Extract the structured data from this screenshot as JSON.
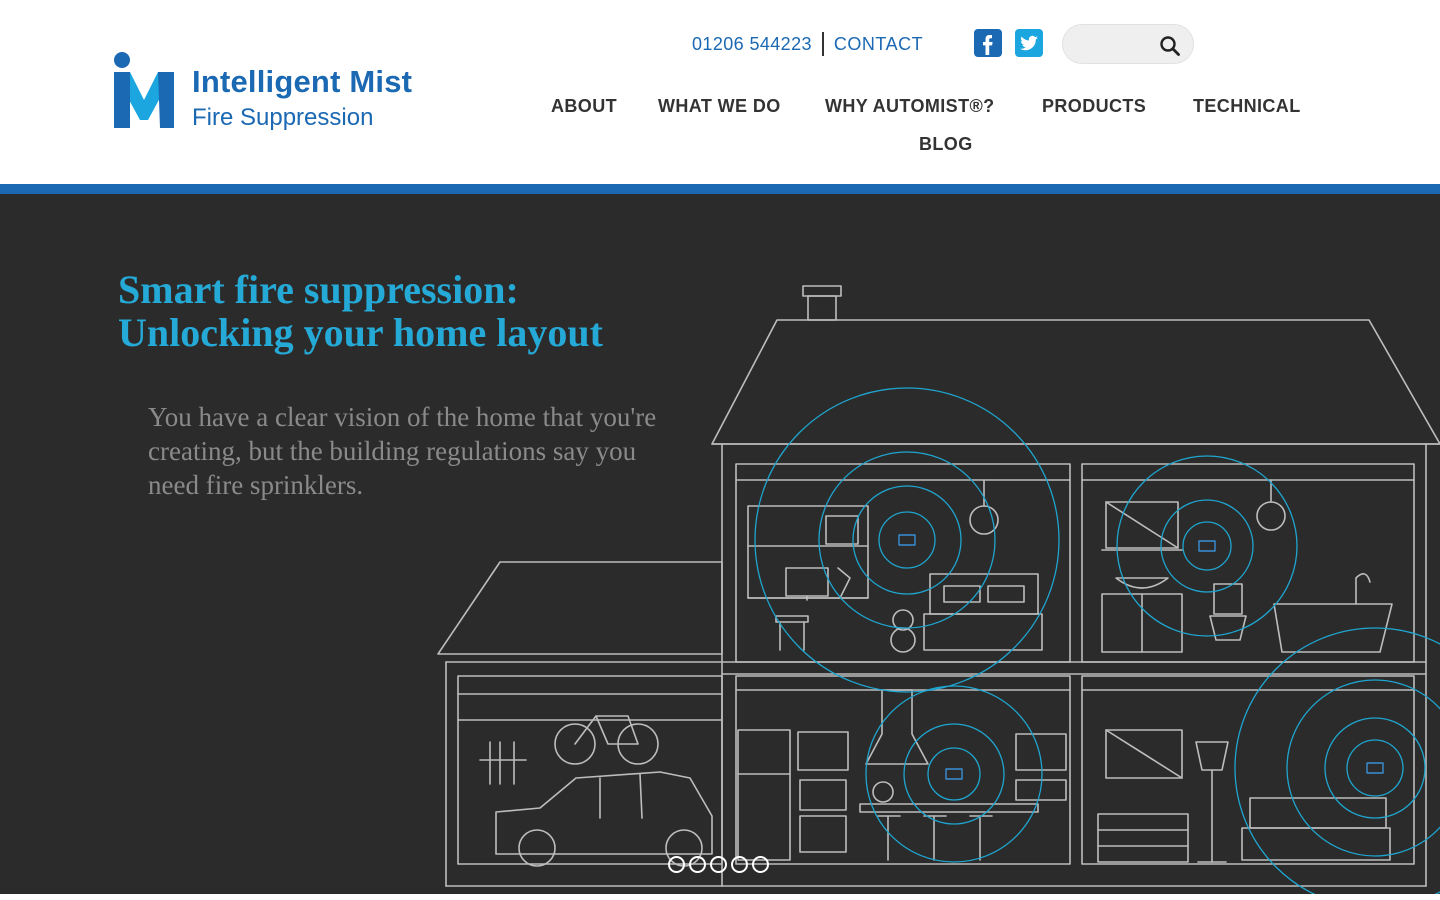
{
  "brand": {
    "line1": "Intelligent Mist",
    "line2": "Fire Suppression",
    "color": "#1b68b3",
    "accent": "#1ba6e0"
  },
  "topbar": {
    "phone": "01206 544223",
    "contact": "CONTACT"
  },
  "social": {
    "facebook_icon": "facebook-icon",
    "twitter_icon": "twitter-icon"
  },
  "search": {
    "placeholder": "",
    "icon": "search-icon"
  },
  "nav": {
    "items": [
      "ABOUT",
      "WHAT WE DO",
      "WHY AUTOMIST®?",
      "PRODUCTS",
      "TECHNICAL",
      "BLOG"
    ]
  },
  "hero": {
    "title_line1": "Smart fire suppression:",
    "title_line2": "Unlocking your home layout",
    "text": "You have a clear vision of the home that you're creating, but the building regulations say you need fire sprinklers.",
    "title_color": "#25a9d6",
    "background": "#2b2b2b",
    "slides": 5
  }
}
